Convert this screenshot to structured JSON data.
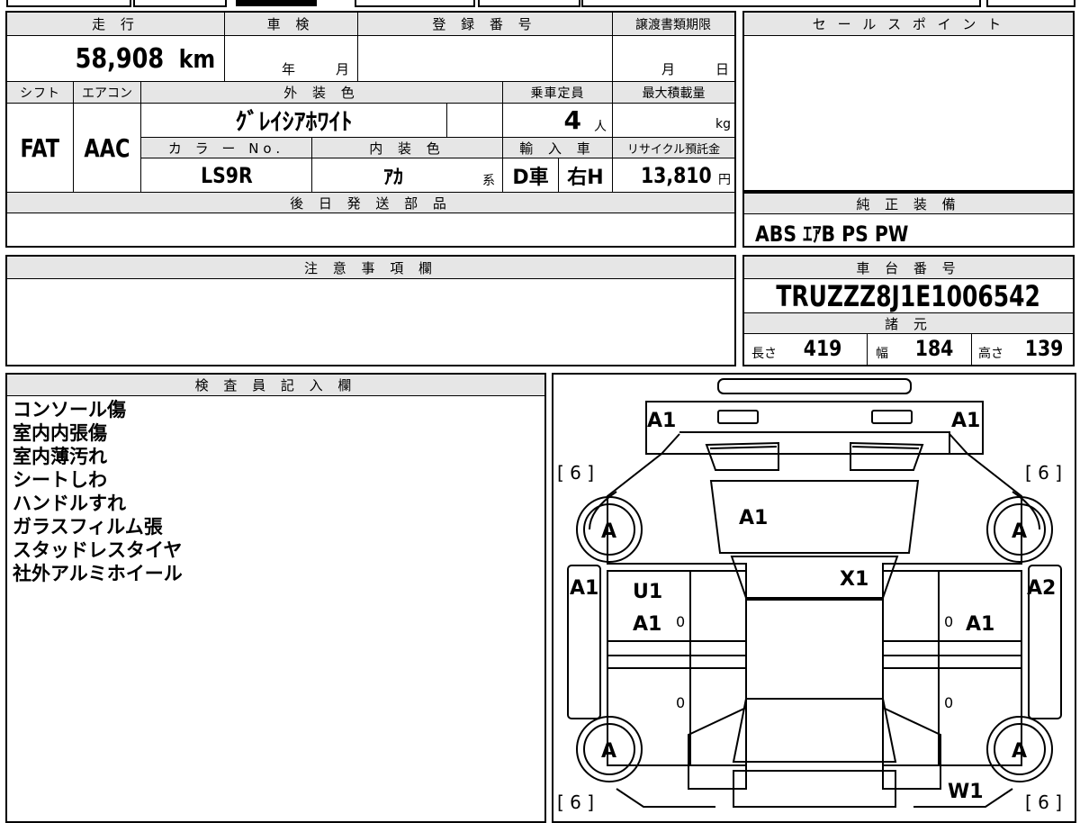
{
  "vehicle": {
    "mileage_label": "走 行",
    "mileage_value": "58,908",
    "mileage_unit": "km",
    "inspection_label": "車 検",
    "inspection_year_unit": "年",
    "inspection_month_unit": "月",
    "registration_label": "登 録 番 号",
    "transfer_label": "譲渡書類期限",
    "transfer_month_unit": "月",
    "transfer_day_unit": "日",
    "shift_label": "シフト",
    "shift_value": "FAT",
    "ac_label": "エアコン",
    "ac_value": "AAC",
    "exterior_label": "外 装 色",
    "exterior_value": "ｸﾞﾚｲｼｱﾎﾜｲﾄ",
    "seating_label": "乗車定員",
    "seating_value": "4",
    "seating_unit": "人",
    "maxload_label": "最大積載量",
    "maxload_unit": "kg",
    "color_no_label": "カ ラ ー No.",
    "color_no_value": "LS9R",
    "interior_label": "内 装 色",
    "interior_value": "ｱｶ",
    "interior_suffix": "系",
    "import_label": "輸 入 車",
    "import_value_1": "D車",
    "import_value_2": "右H",
    "recycle_label": "リサイクル預託金",
    "recycle_value": "13,810",
    "recycle_unit": "円",
    "later_parts_label": "後 日 発 送 部 品",
    "sales_point_label": "セ ー ル ス ポ イ ン ト",
    "equipment_label": "純 正 装 備",
    "equipment_value": "ABS ｴｱB PS PW",
    "notes_label": "注 意 事 項 欄",
    "chassis_label": "車 台 番 号",
    "chassis_value": "TRUZZZ8J1E1006542",
    "specs_label": "諸 元",
    "length_label": "長さ",
    "length_value": "419",
    "width_label": "幅",
    "width_value": "184",
    "height_label": "高さ",
    "height_value": "139"
  },
  "inspector": {
    "label": "検 査 員 記 入 欄",
    "notes": [
      "コンソール傷",
      "室内内張傷",
      "室内薄汚れ",
      "シートしわ",
      "ハンドルすれ",
      "ガラスフィルム張",
      "スタッドレスタイヤ",
      "社外アルミホイール"
    ]
  },
  "diagram": {
    "front_left_bumper": "A1",
    "front_right_bumper": "A1",
    "hood": "A1",
    "windshield": "X1",
    "left_fender": "A1",
    "right_fender": "A2",
    "left_front_door_1": "U1",
    "left_front_door_2": "A1",
    "right_front_door": "A1",
    "rear_right": "W1",
    "tire_fl": "A",
    "tire_fr": "A",
    "tire_rl": "A",
    "tire_rr": "A",
    "tread_fl": "[ 6 ]",
    "tread_fr": "[ 6 ]",
    "tread_rl": "[ 6 ]",
    "tread_rr": "[ 6 ]",
    "zero_lf1": "0",
    "zero_rf1": "0",
    "zero_lf2": "0",
    "zero_rf2": "0"
  }
}
